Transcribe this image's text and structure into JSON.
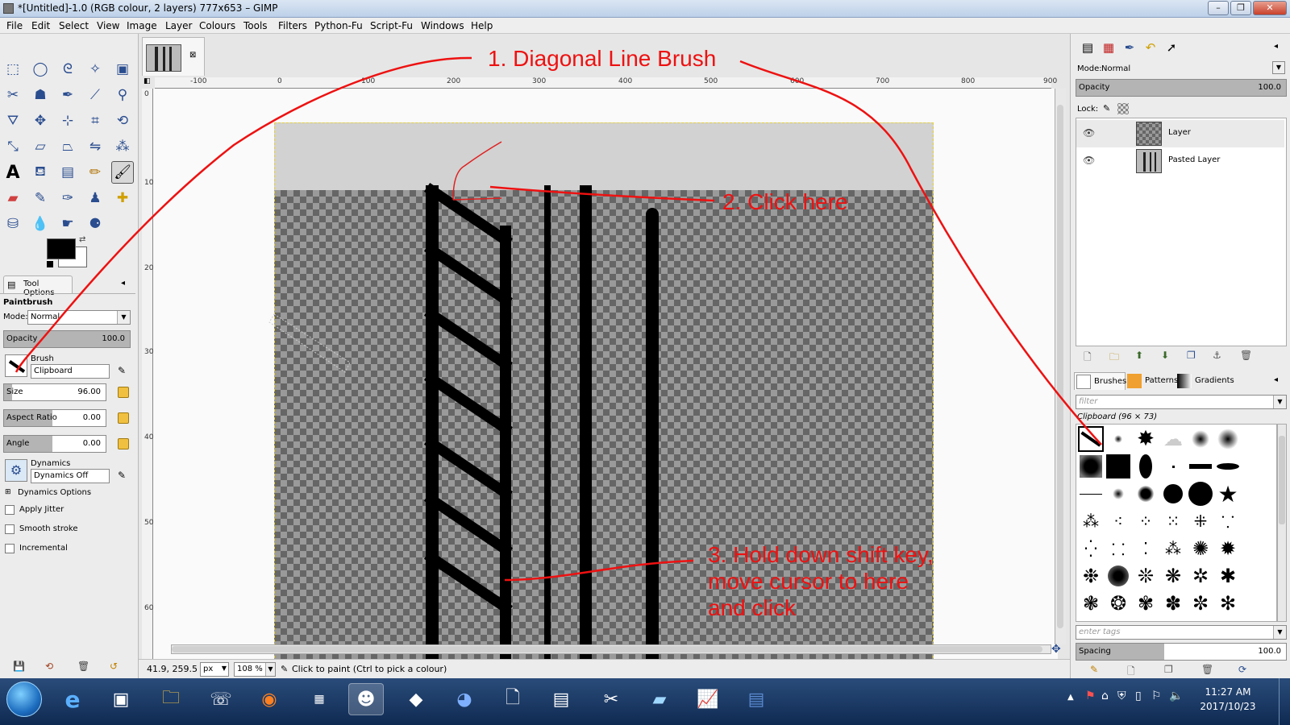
{
  "window": {
    "title": "*[Untitled]-1.0 (RGB colour, 2 layers) 777x653 – GIMP",
    "minimize_label": "–",
    "maximize_label": "❐",
    "close_label": "✕"
  },
  "menu": {
    "items": [
      "File",
      "Edit",
      "Select",
      "View",
      "Image",
      "Layer",
      "Colours",
      "Tools",
      "Filters",
      "Python-Fu",
      "Script-Fu",
      "Windows",
      "Help"
    ]
  },
  "tool_options": {
    "tab_label": "Tool Options",
    "tool_name": "Paintbrush",
    "mode_label": "Mode:",
    "mode_value": "Normal",
    "opacity_label": "Opacity",
    "opacity_value": "100.0",
    "opacity_fraction": 1.0,
    "brush_label": "Brush",
    "brush_value": "Clipboard",
    "size_label": "Size",
    "size_value": "96.00",
    "aspect_label": "Aspect Ratio",
    "aspect_value": "0.00",
    "angle_label": "Angle",
    "angle_value": "0.00",
    "dynamics_label": "Dynamics",
    "dynamics_value": "Dynamics Off",
    "dynamics_options_label": "Dynamics Options",
    "apply_jitter_label": "Apply Jitter",
    "smooth_stroke_label": "Smooth stroke",
    "incremental_label": "Incremental"
  },
  "ruler": {
    "h_ticks": [
      "-100",
      "0",
      "100",
      "200",
      "300",
      "400",
      "500",
      "600",
      "700",
      "800",
      "900"
    ],
    "v_ticks": [
      "0",
      "100",
      "200",
      "300",
      "400",
      "500",
      "600"
    ]
  },
  "status": {
    "coords": "41.9, 259.5",
    "unit": "px",
    "zoom": "108 %",
    "message": "Click to paint (Ctrl to pick a colour)"
  },
  "layers_panel": {
    "mode_label": "Mode:",
    "mode_value": "Normal",
    "opacity_label": "Opacity",
    "opacity_value": "100.0",
    "lock_label": "Lock:",
    "layers": [
      {
        "name": "Layer"
      },
      {
        "name": "Pasted Layer"
      }
    ]
  },
  "brushes_panel": {
    "tabs": [
      "Brushes",
      "Patterns",
      "Gradients"
    ],
    "filter_placeholder": "filter",
    "selected_brush": "Clipboard (96 × 73)",
    "tags_placeholder": "enter tags",
    "spacing_label": "Spacing",
    "spacing_value": "100.0"
  },
  "annotations": {
    "step1": "1. Diagonal Line Brush",
    "step2": "2. Click here",
    "step3_line1": "3. Hold down shift key,",
    "step3_line2": "move cursor to here",
    "step3_line3": "and click"
  },
  "clock": {
    "time": "11:27 AM",
    "date": "2017/10/23"
  },
  "colors": {
    "annotation": "#ee1111",
    "foreground": "#000000",
    "background": "#ffffff"
  }
}
